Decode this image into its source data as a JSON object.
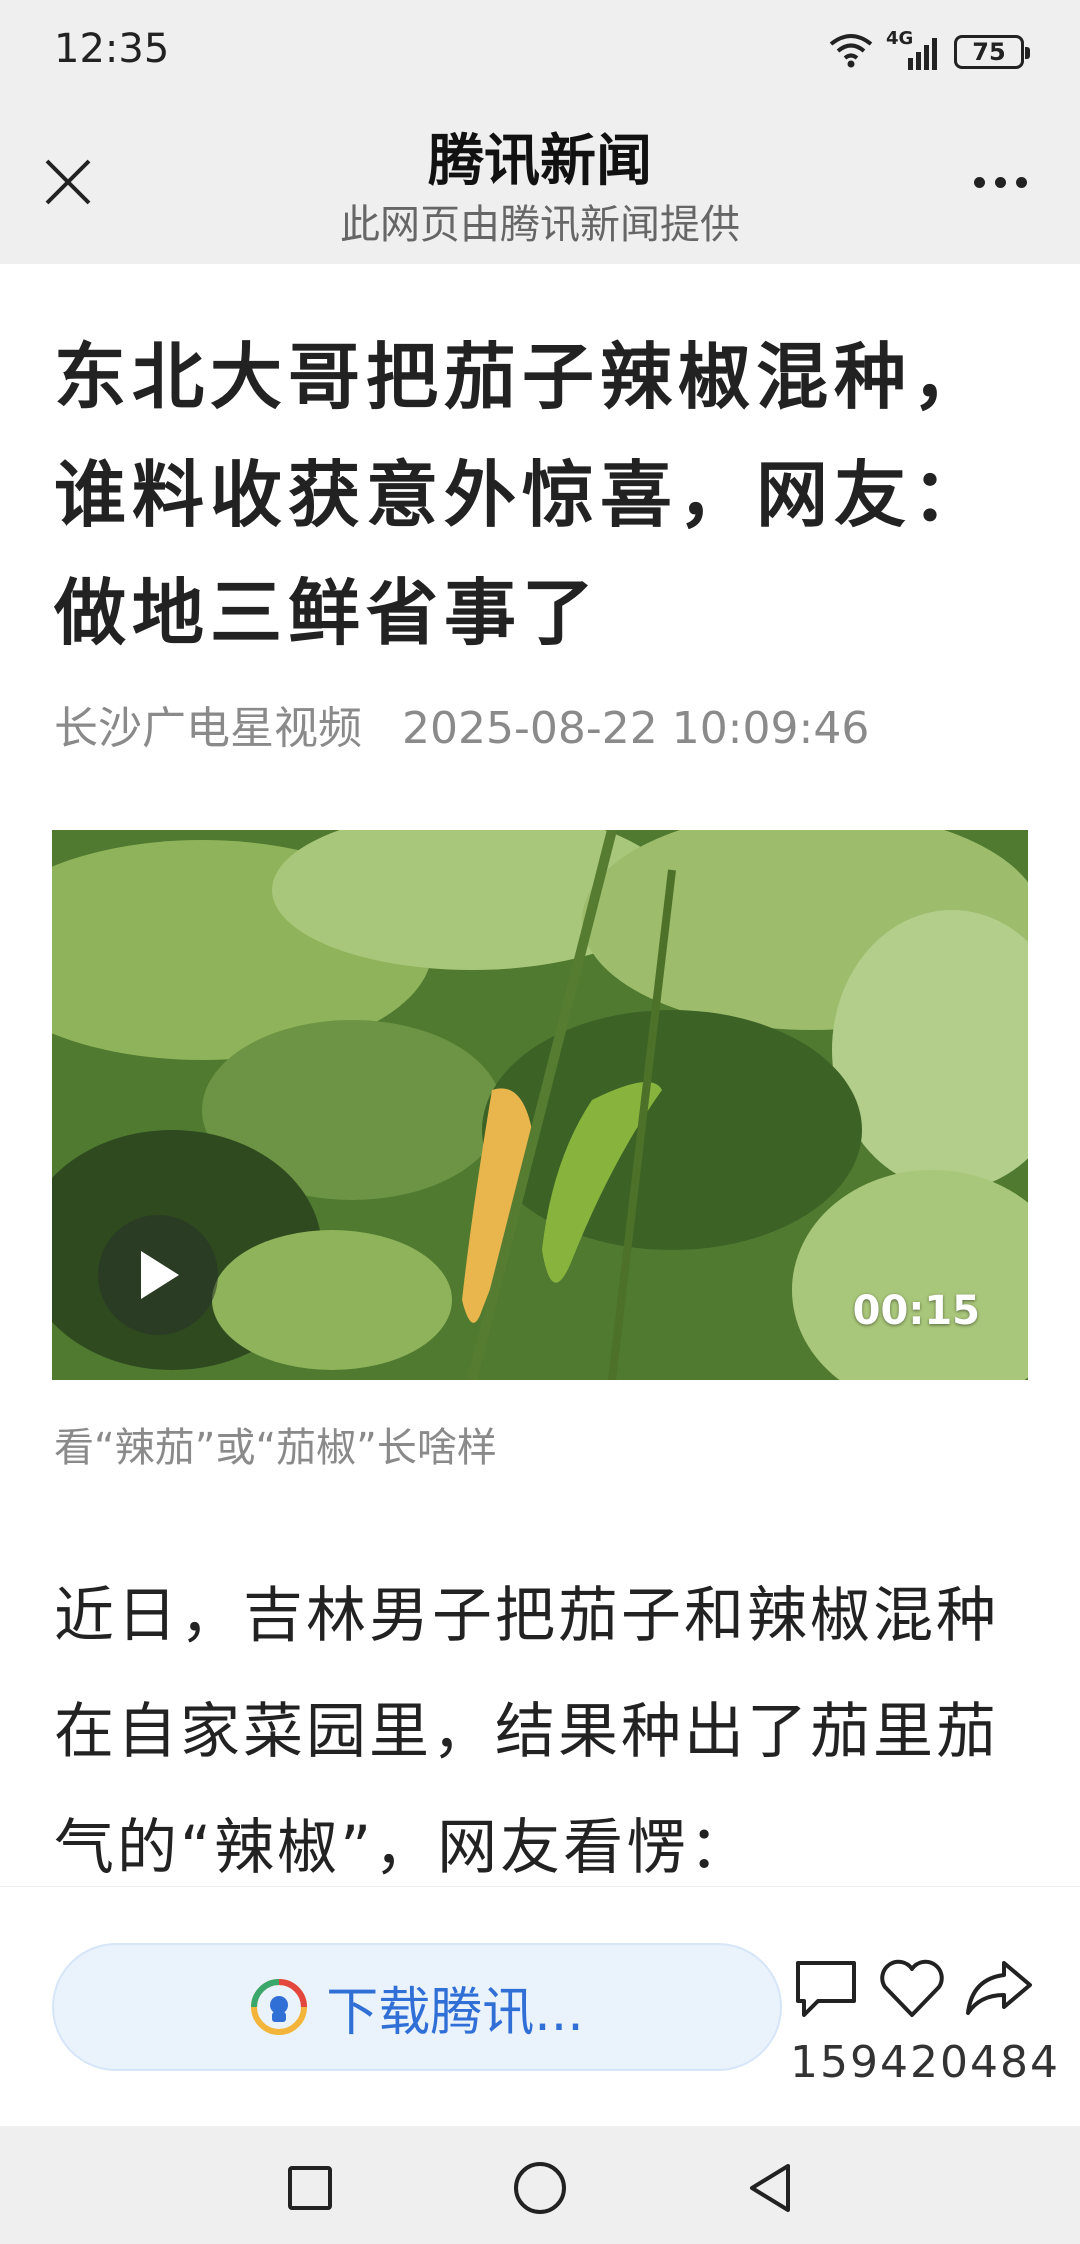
{
  "status_bar": {
    "time": "12:35",
    "network": "4G",
    "battery": "75"
  },
  "nav": {
    "title": "腾讯新闻",
    "subtitle": "此网页由腾讯新闻提供"
  },
  "article": {
    "headline": "东北大哥把茄子辣椒混种，谁料收获意外惊喜，网友：做地三鲜省事了",
    "source": "长沙广电星视频",
    "date": "2025-08-22 10:09:46",
    "video_duration": "00:15",
    "video_caption": "看“辣茄”或“茄椒”长啥样",
    "body": "近日，吉林男子把茄子和辣椒混种在自家菜园里，结果种出了茄里茄气的“辣椒”，网友看愣："
  },
  "actions": {
    "download_label": "下载腾讯...",
    "count": "159420484"
  }
}
